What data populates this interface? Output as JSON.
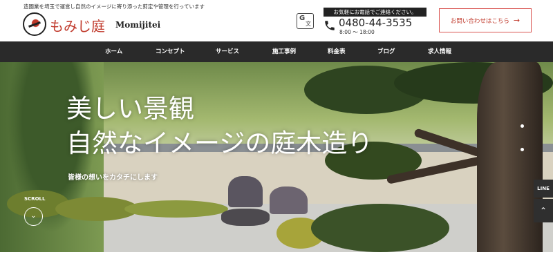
{
  "header": {
    "tagline": "造園業を埼玉で運営し自然のイメージに寄り添った剪定や管理を行っています",
    "logo_jp": "もみじ庭",
    "logo_en": "Momijitei",
    "phone_label": "お気軽にお電話でご連絡ください。",
    "phone_number": "0480-44-3535",
    "phone_hours": "8:00 ～ 18:00",
    "contact_label": "お問い合わせはこちら",
    "contact_arrow": "→"
  },
  "nav": {
    "items": [
      {
        "label": "ホーム"
      },
      {
        "label": "コンセプト"
      },
      {
        "label": "サービス"
      },
      {
        "label": "施工事例"
      },
      {
        "label": "料金表"
      },
      {
        "label": "ブログ"
      },
      {
        "label": "求人情報"
      }
    ]
  },
  "hero": {
    "title_line1": "美しい景観",
    "title_line2": "自然なイメージの庭木造り",
    "subtitle": "皆様の想いをカタチにします",
    "scroll_label": "SCROLL",
    "scroll_icon": "chevron-down-icon"
  },
  "side": {
    "line_label": "LINE",
    "totop_icon": "chevron-up-icon"
  },
  "colors": {
    "brand_red": "#c0392b",
    "nav_bg": "#2a2a2a"
  }
}
